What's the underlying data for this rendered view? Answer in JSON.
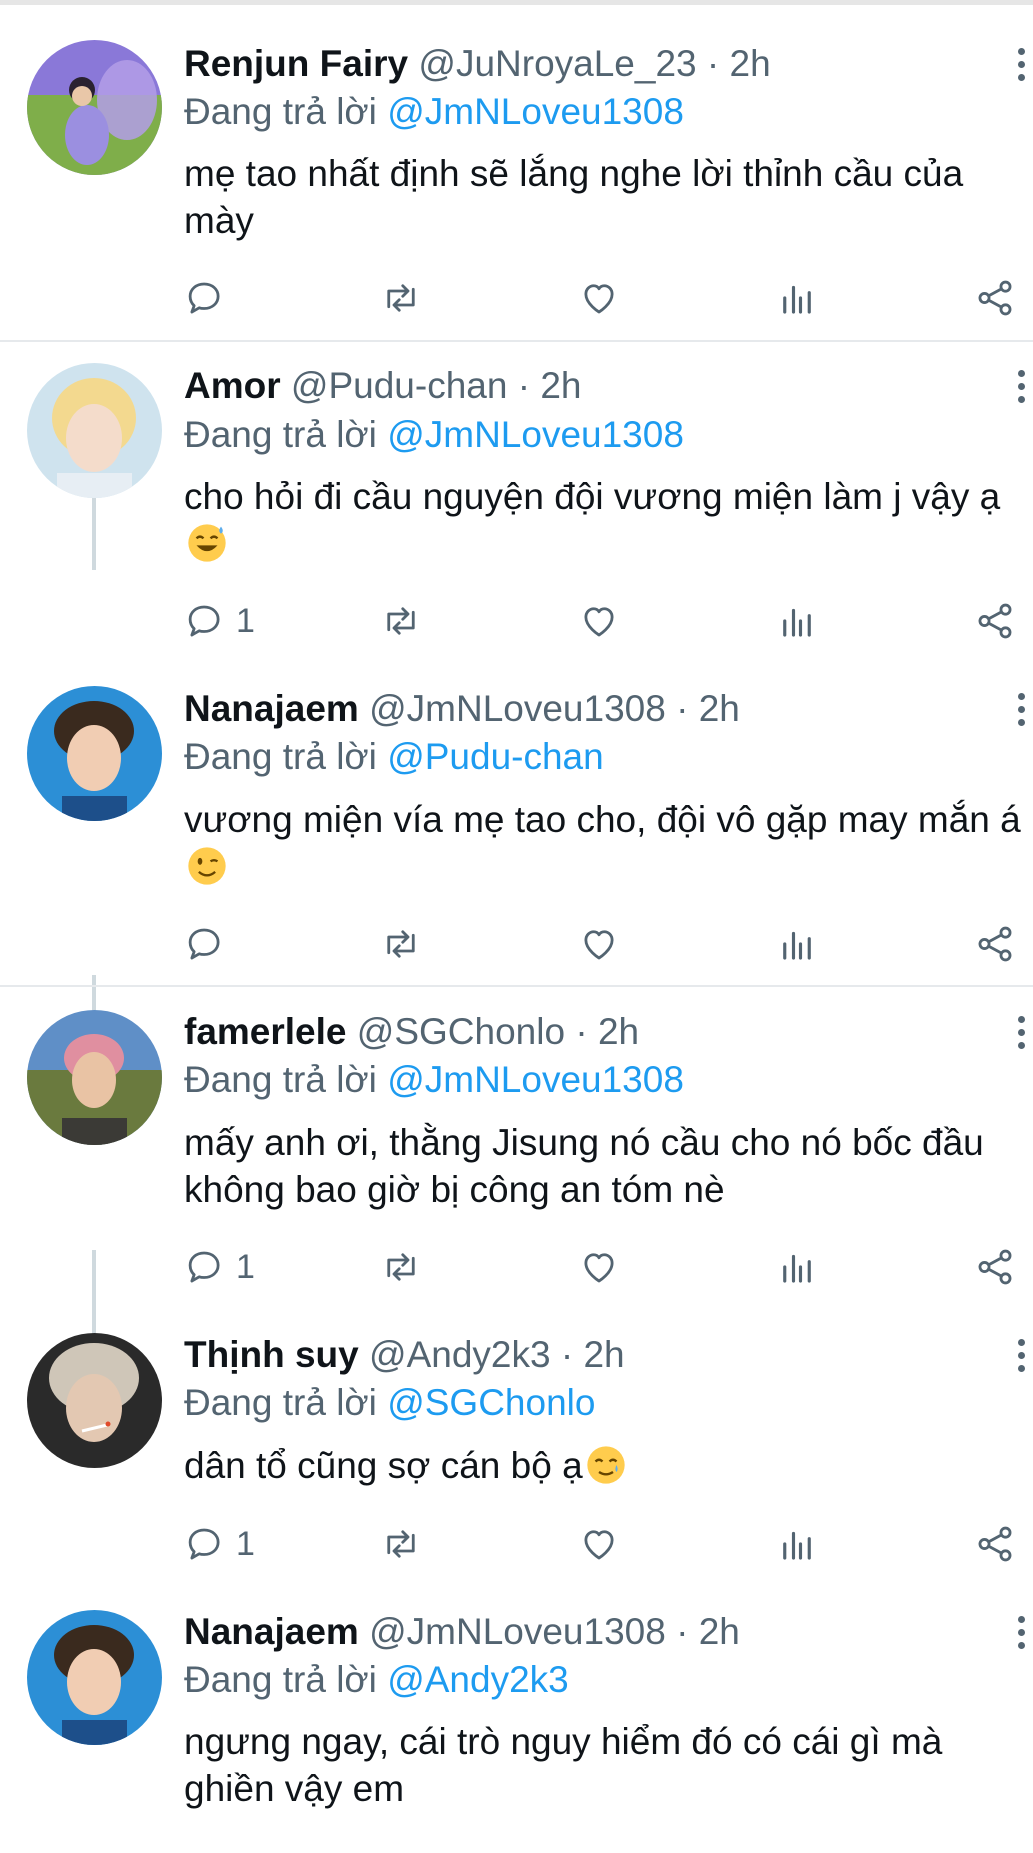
{
  "replying_prefix": "Đang trả lời",
  "icons": {
    "reply": "reply-icon",
    "retweet": "retweet-icon",
    "like": "heart-icon",
    "views": "views-icon",
    "share": "share-icon",
    "more": "more-icon"
  },
  "colors": {
    "link": "#1d9bf0",
    "secondary_text": "#536471",
    "thread_line": "#cfd9de"
  },
  "tweets": [
    {
      "name": "Renjun Fairy",
      "handle": "@JuNroyaLe_23",
      "time": "2h",
      "replying_to": "@JmNLoveu1308",
      "text": "mẹ tao nhất định sẽ lắng nghe lời thỉnh cầu của mày",
      "emoji": "",
      "reply_count": ""
    },
    {
      "name": "Amor",
      "handle": "@Pudu-chan",
      "time": "2h",
      "replying_to": "@JmNLoveu1308",
      "text": "cho hỏi đi cầu nguyện đội vương miện làm j vậy ạ",
      "emoji": "sweat-smile-emoji",
      "reply_count": "1"
    },
    {
      "name": "Nanajaem",
      "handle": "@JmNLoveu1308",
      "time": "2h",
      "replying_to": "@Pudu-chan",
      "text": "vương miện vía mẹ tao cho, đội vô gặp may mắn á",
      "emoji": "wink-emoji",
      "reply_count": ""
    },
    {
      "name": "famerlele",
      "handle": "@SGChonlo",
      "time": "2h",
      "replying_to": "@JmNLoveu1308",
      "text": "mấy anh ơi, thằng Jisung nó cầu cho nó bốc đầu không bao giờ bị công an tóm nè",
      "emoji": "",
      "reply_count": "1"
    },
    {
      "name": "Thịnh suy",
      "handle": "@Andy2k3",
      "time": "2h",
      "replying_to": "@SGChonlo",
      "text": "dân tổ cũng sợ cán bộ ạ",
      "emoji": "tear-smile-emoji",
      "reply_count": "1"
    },
    {
      "name": "Nanajaem",
      "handle": "@JmNLoveu1308",
      "time": "2h",
      "replying_to": "@Andy2k3",
      "text": "ngưng ngay, cái trò nguy hiểm đó có cái gì mà ghiền vậy em",
      "emoji": "",
      "reply_count": ""
    }
  ]
}
